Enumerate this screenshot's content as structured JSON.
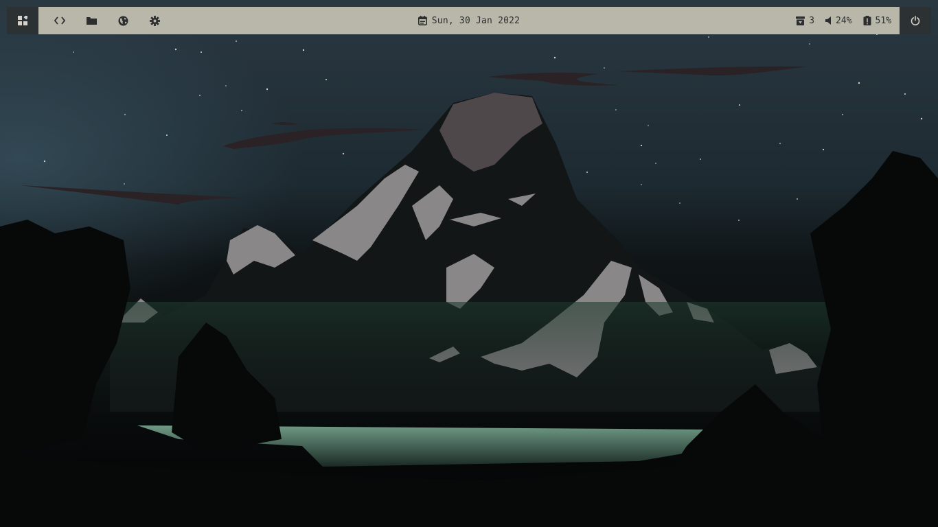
{
  "colors": {
    "bar_background": "#b8b7a9",
    "bar_text": "#2c2e30",
    "corner_block": "#2c3134",
    "sky_top": "#27343d",
    "mountain_snow": "#8a8788",
    "lake": "#6f9a85"
  },
  "topbar": {
    "launcher_icon": "app-grid-icon",
    "apps": [
      {
        "name": "code-icon"
      },
      {
        "name": "folder-icon"
      },
      {
        "name": "globe-icon"
      },
      {
        "name": "gear-icon"
      }
    ],
    "date": "Sun, 30 Jan 2022",
    "status": {
      "updates_count": "3",
      "volume_percent": "24%",
      "battery_percent": "51%"
    },
    "power_icon": "power-icon"
  },
  "wallpaper": {
    "description_icon": "mountain-lake-wallpaper"
  }
}
